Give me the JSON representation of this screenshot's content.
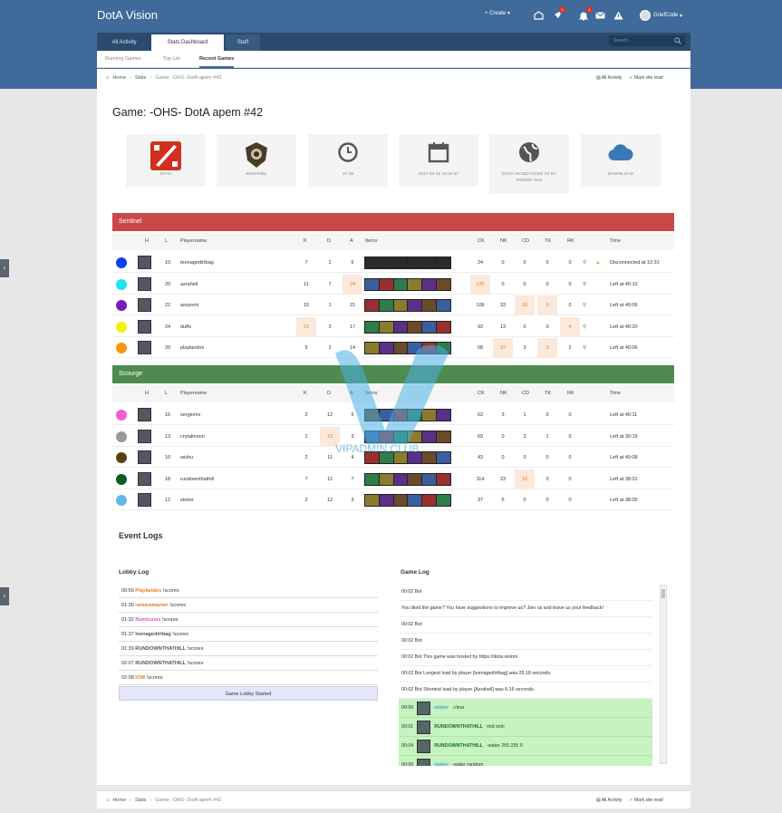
{
  "app": {
    "brand": "DotA Vision",
    "create": "Create",
    "user": "GriefCode",
    "badges": [
      "1",
      "1"
    ]
  },
  "tabs": [
    "All Activity",
    "Stats Dashboard",
    "Staff"
  ],
  "search_placeholder": "Search...",
  "subtabs": [
    "Running Games",
    "Top List",
    "Recent Games"
  ],
  "breadcrumb": [
    "Home",
    "Stats",
    "Game: -OHS- DotA apem #42"
  ],
  "right_links": [
    "All Activity",
    "Mark site read"
  ],
  "title": "Game: -OHS- DotA apem #42",
  "cards": [
    "DOTA",
    "SENTINEL",
    "37:38",
    "2017-04-30 16:50:37",
    "DOTA V6.83D FIXED V2 BY FORMIT WIX",
    "DOWNLOAD"
  ],
  "teams": {
    "sentinel": "Sentinel",
    "scourge": "Scourge"
  },
  "columns": [
    "H",
    "L",
    "Playername",
    "K",
    "D",
    "A",
    "Items",
    "CK",
    "NK",
    "CD",
    "TK",
    "RK",
    "Time"
  ],
  "sentinel_rows": [
    {
      "color": "#0a3ff0",
      "level": "10",
      "name": "teenagedirtbag",
      "k": "7",
      "d": "1",
      "a": "6",
      "ck": "24",
      "nk": "0",
      "cd": "0",
      "tk": "0",
      "rk": "0",
      "time": "Disconnected at 10:31",
      "warn": true
    },
    {
      "color": "#1de6ef",
      "level": "20",
      "name": "azrahell",
      "k": "11",
      "d": "7",
      "a": "24",
      "ck": "120",
      "nk": "0",
      "cd": "0",
      "tk": "0",
      "rk": "0",
      "time": "Left at 40:10"
    },
    {
      "color": "#7a1ab8",
      "level": "22",
      "name": "assyomi",
      "k": "15",
      "d": "1",
      "a": "21",
      "ck": "106",
      "nk": "33",
      "cd": "10",
      "tk": "3",
      "rk": "0",
      "time": "Left at 40:06"
    },
    {
      "color": "#f7f200",
      "level": "24",
      "name": "duffo",
      "k": "21",
      "d": "3",
      "a": "17",
      "ck": "92",
      "nk": "13",
      "cd": "0",
      "tk": "0",
      "rk": "4",
      "time": "Left at 40:20"
    },
    {
      "color": "#f8960c",
      "level": "20",
      "name": "playlandox",
      "k": "5",
      "d": "3",
      "a": "14",
      "ck": "68",
      "nk": "37",
      "cd": "3",
      "tk": "3",
      "rk": "2",
      "time": "Left at 40:06"
    }
  ],
  "scourge_rows": [
    {
      "color": "#f25ed1",
      "level": "16",
      "name": "sergiomv",
      "k": "2",
      "d": "12",
      "a": "5",
      "ck": "62",
      "nk": "3",
      "cd": "1",
      "tk": "0",
      "rk": "0",
      "time": "Left at 40:11"
    },
    {
      "color": "#9a9a9a",
      "level": "13",
      "name": "crytalmoon",
      "k": "1",
      "d": "13",
      "a": "3",
      "ck": "69",
      "nk": "0",
      "cd": "3",
      "tk": "1",
      "rk": "0",
      "time": "Left at 30:19"
    },
    {
      "color": "#5a4210",
      "level": "10",
      "name": "wishu",
      "k": "2",
      "d": "11",
      "a": "4",
      "ck": "43",
      "nk": "0",
      "cd": "0",
      "tk": "0",
      "rk": "0",
      "time": "Left at 40:08"
    },
    {
      "color": "#0a5e22",
      "level": "18",
      "name": "rundownthathill",
      "k": "7",
      "d": "11",
      "a": "7",
      "ck": "114",
      "nk": "23",
      "cd": "10",
      "tk": "0",
      "rk": "0",
      "time": "Left at 38:01"
    },
    {
      "color": "#62b8ea",
      "level": "12",
      "name": "stoker",
      "k": "2",
      "d": "12",
      "a": "3",
      "ck": "37",
      "nk": "6",
      "cd": "0",
      "tk": "0",
      "rk": "0",
      "time": "Left at 38:05"
    }
  ],
  "event_logs": "Event Logs",
  "lobby_title": "Lobby Log",
  "lobby": [
    {
      "t": "00:56",
      "n": "Playlandox",
      "c": "#e67e22",
      "m": "!scores"
    },
    {
      "t": "01:30",
      "n": "ramaramaram",
      "c": "#e67e22",
      "m": "!scores"
    },
    {
      "t": "01:32",
      "n": "Bambunas",
      "c": "#e85fc5",
      "m": "!scores"
    },
    {
      "t": "01:37",
      "n": "teenagedirtbag",
      "c": "#555",
      "m": "!scores"
    },
    {
      "t": "01:39",
      "n": "RUNDOWNTHATHILL",
      "c": "#555",
      "m": "!scores"
    },
    {
      "t": "02:07",
      "n": "RUNDOWNTHATHILL",
      "c": "#555",
      "m": "!scores"
    },
    {
      "t": "02:08",
      "n": "IOW",
      "c": "#e67e22",
      "m": "!scores"
    }
  ],
  "lobby_started": "Game Lobby Started",
  "game_title": "Game Log",
  "game": [
    "00:02  Bot",
    "You liked the game? You have suggestions to improve us? Join us and leave us your feedback!",
    "00:02  Bot",
    "00:02  Bot",
    "00:02  Bot  This game was hosted by https://dota.vision/",
    "00:02  Bot  Longest load by player [teenagedirtbag] was 25.18 seconds.",
    "00:02  Bot  Shortest load by player [Azrahell] was 6.16 seconds."
  ],
  "game_green": [
    {
      "t": "00:00",
      "n": "stoker",
      "c": "#4aa3df",
      "m": "-clear"
    },
    {
      "t": "00:01",
      "n": "RUNDOWNTHATHILL",
      "c": "#1a6b2e",
      "m": "mid solo"
    },
    {
      "t": "00:04",
      "n": "RUNDOWNTHATHILL",
      "c": "#1a6b2e",
      "m": "-water 255 255 0"
    },
    {
      "t": "00:09",
      "n": "stoker",
      "c": "#4aa3df",
      "m": "-water random"
    }
  ],
  "watermark": "VIPADMIN.CLUB",
  "colors": {
    "sentinel": "#c9494a",
    "scourge": "#4f8b4f",
    "header": "#3f6a9a",
    "highlight": "#fbe9dc"
  }
}
